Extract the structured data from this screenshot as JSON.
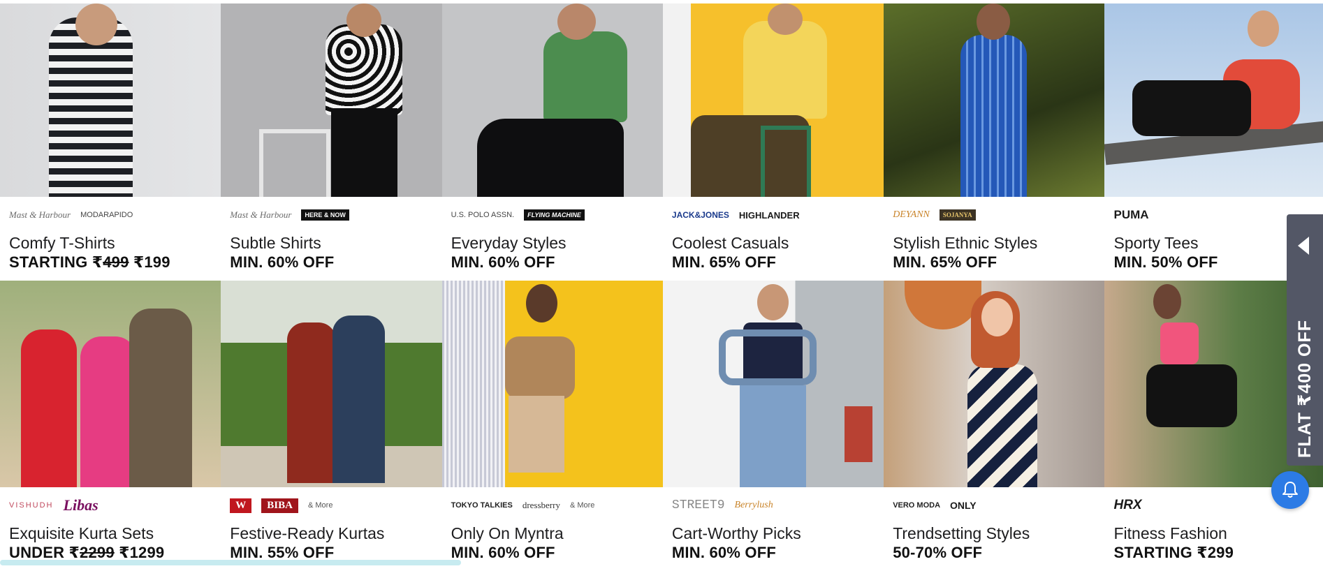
{
  "row1": [
    {
      "logos": [
        "Mast & Harbour",
        "MODARAPIDO"
      ],
      "title": "Comfy T-Shirts",
      "offer_prefix": "STARTING ₹",
      "offer_strike": "499",
      "offer_suffix": " ₹199"
    },
    {
      "logos": [
        "Mast & Harbour",
        "HERE & NOW"
      ],
      "title": "Subtle Shirts",
      "offer": "MIN. 60% OFF"
    },
    {
      "logos": [
        "U.S. POLO ASSN.",
        "FLYING MACHINE"
      ],
      "title": "Everyday Styles",
      "offer": "MIN. 60% OFF"
    },
    {
      "logos": [
        "JACK&JONES",
        "HIGHLANDER"
      ],
      "title": "Coolest Casuals",
      "offer": "MIN. 65% OFF"
    },
    {
      "logos": [
        "DEYANN",
        "SOJANYA"
      ],
      "title": "Stylish Ethnic Styles",
      "offer": "MIN. 65% OFF"
    },
    {
      "logos": [
        "PUMA"
      ],
      "title": "Sporty Tees",
      "offer": "MIN. 50% OFF"
    }
  ],
  "row2": [
    {
      "logos": [
        "VISHUDH",
        "Libas"
      ],
      "title": "Exquisite Kurta Sets",
      "offer_prefix": "UNDER ₹",
      "offer_strike": "2299",
      "offer_suffix": " ₹1299"
    },
    {
      "logos": [
        "W",
        "BIBA",
        "& More"
      ],
      "title": "Festive-Ready Kurtas",
      "offer": "MIN. 55% OFF"
    },
    {
      "logos": [
        "TOKYO TALKIES",
        "dressberry",
        "& More"
      ],
      "title": "Only On Myntra",
      "offer": "MIN. 60% OFF"
    },
    {
      "logos": [
        "STREET9",
        "Berrylush"
      ],
      "title": "Cart-Worthy Picks",
      "offer": "MIN. 60% OFF"
    },
    {
      "logos": [
        "VERO MODA",
        "ONLY"
      ],
      "title": "Trendsetting Styles",
      "offer": "50-70% OFF"
    },
    {
      "logos": [
        "HRX"
      ],
      "title": "Fitness Fashion",
      "offer": "STARTING ₹299"
    }
  ],
  "side_banner": {
    "text": "FLAT ₹400 OFF",
    "icon": "chevron-left-icon"
  },
  "notification": {
    "icon": "bell-icon"
  },
  "colors": {
    "side_banner": "#535766",
    "bell": "#2c7be5",
    "text": "#1d1d1f"
  }
}
